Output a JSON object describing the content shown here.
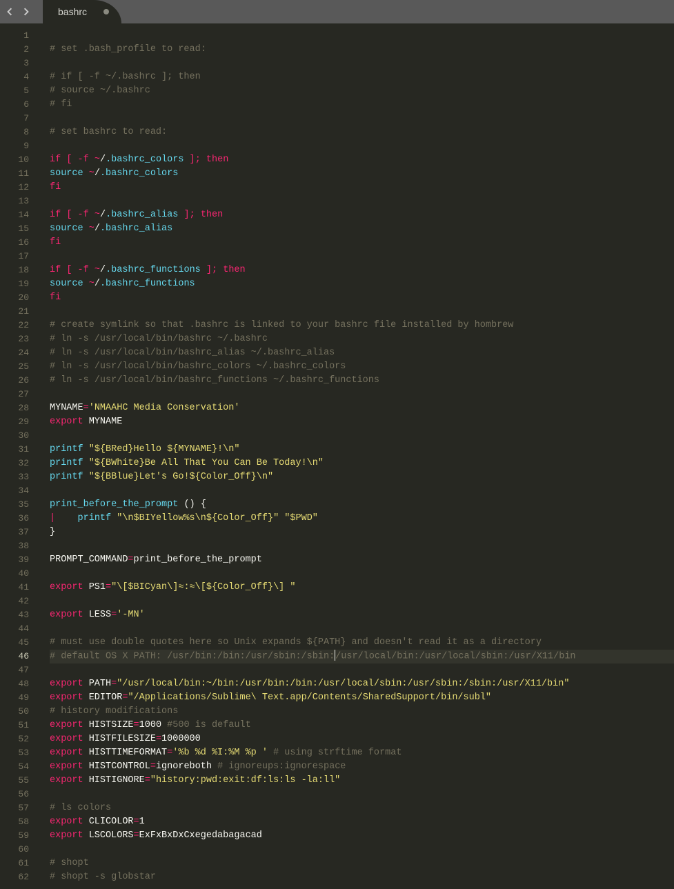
{
  "tab": {
    "title": "bashrc",
    "dirty": true
  },
  "active_line": 46,
  "lines": [
    {
      "n": 1,
      "t": []
    },
    {
      "n": 2,
      "t": [
        [
          "c",
          "# set .bash_profile to read:"
        ]
      ]
    },
    {
      "n": 3,
      "t": []
    },
    {
      "n": 4,
      "t": [
        [
          "c",
          "# if [ -f ~/.bashrc ]; then"
        ]
      ]
    },
    {
      "n": 5,
      "t": [
        [
          "c",
          "# source ~/.bashrc"
        ]
      ]
    },
    {
      "n": 6,
      "t": [
        [
          "c",
          "# fi"
        ]
      ]
    },
    {
      "n": 7,
      "t": []
    },
    {
      "n": 8,
      "t": [
        [
          "c",
          "# set bashrc to read:"
        ]
      ]
    },
    {
      "n": 9,
      "t": []
    },
    {
      "n": 10,
      "t": [
        [
          "kw",
          "if"
        ],
        [
          "w",
          " "
        ],
        [
          "kw",
          "["
        ],
        [
          "w",
          " "
        ],
        [
          "op",
          "-f"
        ],
        [
          "w",
          " "
        ],
        [
          "op",
          "~"
        ],
        [
          "w",
          "/"
        ],
        [
          "b",
          ".bashrc_colors"
        ],
        [
          "w",
          " "
        ],
        [
          "kw",
          "]"
        ],
        [
          "op",
          ";"
        ],
        [
          "w",
          " "
        ],
        [
          "kw",
          "then"
        ]
      ]
    },
    {
      "n": 11,
      "t": [
        [
          "b",
          "source"
        ],
        [
          "w",
          " "
        ],
        [
          "op",
          "~"
        ],
        [
          "w",
          "/"
        ],
        [
          "b",
          ".bashrc_colors"
        ]
      ]
    },
    {
      "n": 12,
      "t": [
        [
          "kw",
          "fi"
        ]
      ]
    },
    {
      "n": 13,
      "t": []
    },
    {
      "n": 14,
      "t": [
        [
          "kw",
          "if"
        ],
        [
          "w",
          " "
        ],
        [
          "kw",
          "["
        ],
        [
          "w",
          " "
        ],
        [
          "op",
          "-f"
        ],
        [
          "w",
          " "
        ],
        [
          "op",
          "~"
        ],
        [
          "w",
          "/"
        ],
        [
          "b",
          ".bashrc_alias"
        ],
        [
          "w",
          " "
        ],
        [
          "kw",
          "]"
        ],
        [
          "op",
          ";"
        ],
        [
          "w",
          " "
        ],
        [
          "kw",
          "then"
        ]
      ]
    },
    {
      "n": 15,
      "t": [
        [
          "b",
          "source"
        ],
        [
          "w",
          " "
        ],
        [
          "op",
          "~"
        ],
        [
          "w",
          "/"
        ],
        [
          "b",
          ".bashrc_alias"
        ]
      ]
    },
    {
      "n": 16,
      "t": [
        [
          "kw",
          "fi"
        ]
      ]
    },
    {
      "n": 17,
      "t": []
    },
    {
      "n": 18,
      "t": [
        [
          "kw",
          "if"
        ],
        [
          "w",
          " "
        ],
        [
          "kw",
          "["
        ],
        [
          "w",
          " "
        ],
        [
          "op",
          "-f"
        ],
        [
          "w",
          " "
        ],
        [
          "op",
          "~"
        ],
        [
          "w",
          "/"
        ],
        [
          "b",
          ".bashrc_functions"
        ],
        [
          "w",
          " "
        ],
        [
          "kw",
          "]"
        ],
        [
          "op",
          ";"
        ],
        [
          "w",
          " "
        ],
        [
          "kw",
          "then"
        ]
      ]
    },
    {
      "n": 19,
      "t": [
        [
          "b",
          "source"
        ],
        [
          "w",
          " "
        ],
        [
          "op",
          "~"
        ],
        [
          "w",
          "/"
        ],
        [
          "b",
          ".bashrc_functions"
        ]
      ]
    },
    {
      "n": 20,
      "t": [
        [
          "kw",
          "fi"
        ]
      ]
    },
    {
      "n": 21,
      "t": []
    },
    {
      "n": 22,
      "t": [
        [
          "c",
          "# create symlink so that .bashrc is linked to your bashrc file installed by hombrew"
        ]
      ]
    },
    {
      "n": 23,
      "t": [
        [
          "c",
          "# ln -s /usr/local/bin/bashrc ~/.bashrc"
        ]
      ]
    },
    {
      "n": 24,
      "t": [
        [
          "c",
          "# ln -s /usr/local/bin/bashrc_alias ~/.bashrc_alias"
        ]
      ]
    },
    {
      "n": 25,
      "t": [
        [
          "c",
          "# ln -s /usr/local/bin/bashrc_colors ~/.bashrc_colors"
        ]
      ]
    },
    {
      "n": 26,
      "t": [
        [
          "c",
          "# ln -s /usr/local/bin/bashrc_functions ~/.bashrc_functions"
        ]
      ]
    },
    {
      "n": 27,
      "t": []
    },
    {
      "n": 28,
      "t": [
        [
          "w",
          "MYNAME"
        ],
        [
          "op",
          "="
        ],
        [
          "s",
          "'NMAAHC Media Conservation'"
        ]
      ]
    },
    {
      "n": 29,
      "t": [
        [
          "kw",
          "export"
        ],
        [
          "w",
          " MYNAME"
        ]
      ]
    },
    {
      "n": 30,
      "t": []
    },
    {
      "n": 31,
      "t": [
        [
          "b",
          "printf"
        ],
        [
          "w",
          " "
        ],
        [
          "s",
          "\"${BRed}Hello ${MYNAME}!\\n\""
        ]
      ]
    },
    {
      "n": 32,
      "t": [
        [
          "b",
          "printf"
        ],
        [
          "w",
          " "
        ],
        [
          "s",
          "\"${BWhite}Be All That You Can Be Today!\\n\""
        ]
      ]
    },
    {
      "n": 33,
      "t": [
        [
          "b",
          "printf"
        ],
        [
          "w",
          " "
        ],
        [
          "s",
          "\"${BBlue}Let's Go!${Color_Off}\\n\""
        ]
      ]
    },
    {
      "n": 34,
      "t": []
    },
    {
      "n": 35,
      "t": [
        [
          "b",
          "print_before_the_prompt"
        ],
        [
          "w",
          " () {"
        ]
      ]
    },
    {
      "n": 36,
      "t": [
        [
          "kw",
          "|"
        ],
        [
          "w",
          "    "
        ],
        [
          "b",
          "printf"
        ],
        [
          "w",
          " "
        ],
        [
          "s",
          "\"\\n$BIYellow%s\\n${Color_Off}\""
        ],
        [
          "w",
          " "
        ],
        [
          "s",
          "\"$PWD\""
        ]
      ]
    },
    {
      "n": 37,
      "t": [
        [
          "w",
          "}"
        ]
      ]
    },
    {
      "n": 38,
      "t": []
    },
    {
      "n": 39,
      "t": [
        [
          "w",
          "PROMPT_COMMAND"
        ],
        [
          "op",
          "="
        ],
        [
          "w",
          "print_before_the_prompt"
        ]
      ]
    },
    {
      "n": 40,
      "t": []
    },
    {
      "n": 41,
      "t": [
        [
          "kw",
          "export"
        ],
        [
          "w",
          " PS1"
        ],
        [
          "op",
          "="
        ],
        [
          "s",
          "\"\\[$BICyan\\]≈:≈\\[${Color_Off}\\] \""
        ]
      ]
    },
    {
      "n": 42,
      "t": []
    },
    {
      "n": 43,
      "t": [
        [
          "kw",
          "export"
        ],
        [
          "w",
          " LESS"
        ],
        [
          "op",
          "="
        ],
        [
          "s",
          "'-MN'"
        ]
      ]
    },
    {
      "n": 44,
      "t": []
    },
    {
      "n": 45,
      "t": [
        [
          "c",
          "# must use double quotes here so Unix expands ${PATH} and doesn't read it as a directory"
        ]
      ]
    },
    {
      "n": 46,
      "t": [
        [
          "c",
          "# default OS X PATH: /usr/bin:/bin:/usr/sbin:/sbin:"
        ],
        [
          "cursor",
          ""
        ],
        [
          "c",
          "/usr/local/bin:/usr/local/sbin:/usr/X11/bin"
        ]
      ]
    },
    {
      "n": 47,
      "t": []
    },
    {
      "n": 48,
      "t": [
        [
          "kw",
          "export"
        ],
        [
          "w",
          " PATH"
        ],
        [
          "op",
          "="
        ],
        [
          "s",
          "\"/usr/local/bin:~/bin:/usr/bin:/bin:/usr/local/sbin:/usr/sbin:/sbin:/usr/X11/bin\""
        ]
      ]
    },
    {
      "n": 49,
      "t": [
        [
          "kw",
          "export"
        ],
        [
          "w",
          " EDITOR"
        ],
        [
          "op",
          "="
        ],
        [
          "s",
          "\"/Applications/Sublime\\ Text.app/Contents/SharedSupport/bin/subl\""
        ]
      ]
    },
    {
      "n": 50,
      "t": [
        [
          "c",
          "# history modifications"
        ]
      ]
    },
    {
      "n": 51,
      "t": [
        [
          "kw",
          "export"
        ],
        [
          "w",
          " HISTSIZE"
        ],
        [
          "op",
          "="
        ],
        [
          "w",
          "1000"
        ],
        [
          "w",
          " "
        ],
        [
          "c",
          "#500 is default"
        ]
      ]
    },
    {
      "n": 52,
      "t": [
        [
          "kw",
          "export"
        ],
        [
          "w",
          " HISTFILESIZE"
        ],
        [
          "op",
          "="
        ],
        [
          "w",
          "1000000"
        ]
      ]
    },
    {
      "n": 53,
      "t": [
        [
          "kw",
          "export"
        ],
        [
          "w",
          " HISTTIMEFORMAT"
        ],
        [
          "op",
          "="
        ],
        [
          "s",
          "'%b %d %I:%M %p '"
        ],
        [
          "w",
          " "
        ],
        [
          "c",
          "# using strftime format"
        ]
      ]
    },
    {
      "n": 54,
      "t": [
        [
          "kw",
          "export"
        ],
        [
          "w",
          " HISTCONTROL"
        ],
        [
          "op",
          "="
        ],
        [
          "w",
          "ignoreboth "
        ],
        [
          "c",
          "# ignoreups:ignorespace"
        ]
      ]
    },
    {
      "n": 55,
      "t": [
        [
          "kw",
          "export"
        ],
        [
          "w",
          " HISTIGNORE"
        ],
        [
          "op",
          "="
        ],
        [
          "s",
          "\"history:pwd:exit:df:ls:ls -la:ll\""
        ]
      ]
    },
    {
      "n": 56,
      "t": []
    },
    {
      "n": 57,
      "t": [
        [
          "c",
          "# ls colors"
        ]
      ]
    },
    {
      "n": 58,
      "t": [
        [
          "kw",
          "export"
        ],
        [
          "w",
          " CLICOLOR"
        ],
        [
          "op",
          "="
        ],
        [
          "w",
          "1"
        ]
      ]
    },
    {
      "n": 59,
      "t": [
        [
          "kw",
          "export"
        ],
        [
          "w",
          " LSCOLORS"
        ],
        [
          "op",
          "="
        ],
        [
          "w",
          "ExFxBxDxCxegedabagacad"
        ]
      ]
    },
    {
      "n": 60,
      "t": []
    },
    {
      "n": 61,
      "t": [
        [
          "c",
          "# shopt"
        ]
      ]
    },
    {
      "n": 62,
      "t": [
        [
          "c",
          "# shopt -s globstar"
        ]
      ]
    }
  ]
}
